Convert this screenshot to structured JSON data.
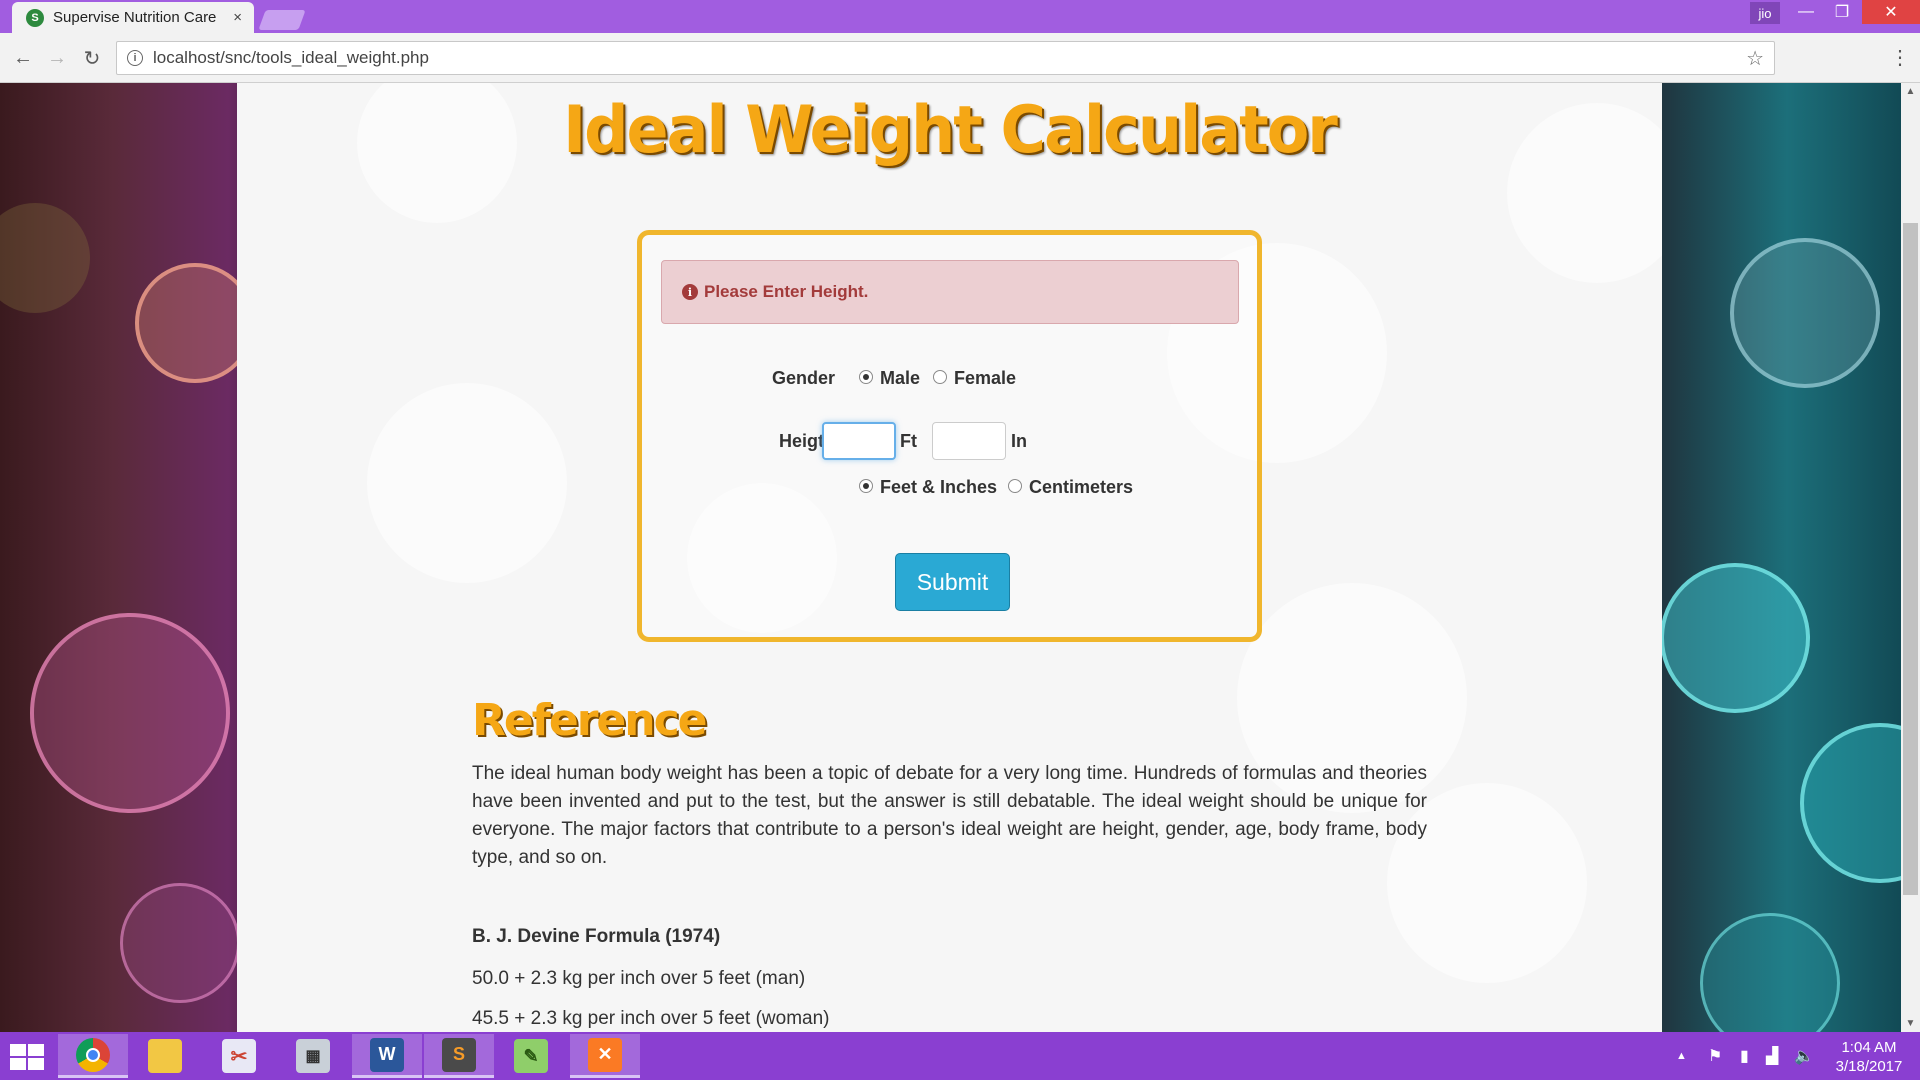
{
  "browser": {
    "tab_title": "Supervise Nutrition Care",
    "tab_close": "×",
    "profile_label": "jio",
    "url": "localhost/snc/tools_ideal_weight.php"
  },
  "page": {
    "title": "Ideal Weight Calculator",
    "alert": "Please Enter Height.",
    "form": {
      "gender_label": "Gender",
      "gender_options": [
        "Male",
        "Female"
      ],
      "gender_selected": "Male",
      "height_label": "Heigth",
      "feet_unit": "Ft",
      "inch_unit": "In",
      "feet_value": "",
      "inch_value": "",
      "unit_options": [
        "Feet & Inches",
        "Centimeters"
      ],
      "unit_selected": "Feet & Inches",
      "submit_label": "Submit"
    },
    "reference": {
      "title": "Reference",
      "text": "The ideal human body weight has been a topic of debate for a very long time. Hundreds of formulas and theories have been invented and put to the test, but the answer is still debatable. The ideal weight should be unique for everyone. The major factors that contribute to a person's ideal weight are height, gender, age, body frame, body type, and so on.",
      "formula_title": "B. J. Devine Formula (1974)",
      "formula_lines": [
        "50.0 + 2.3 kg per inch over 5 feet (man)",
        "45.5 + 2.3 kg per inch over 5 feet (woman)"
      ]
    }
  },
  "taskbar": {
    "apps": [
      "chrome-icon",
      "file-explorer-icon",
      "snipping-tool-icon",
      "calculator-icon",
      "word-icon",
      "sublime-text-icon",
      "notepad-plus-icon",
      "xampp-icon"
    ],
    "active_app": "chrome-icon",
    "time": "1:04 AM",
    "date": "3/18/2017"
  },
  "colors": {
    "accent_title": "#f5a715",
    "box_border": "#f0b62d",
    "alert_text": "#a33b3b",
    "submit_bg": "#2aa9d4",
    "taskbar": "#8a3fd1",
    "titlebar": "#a15de0"
  }
}
